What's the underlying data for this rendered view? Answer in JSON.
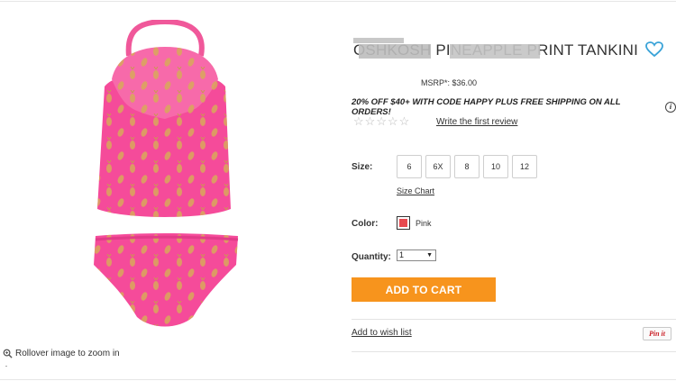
{
  "product": {
    "title": "OSHKOSH PINEAPPLE PRINT TANKINI",
    "msrp": "MSRP*: $36.00",
    "promo": "20% OFF $40+ WITH CODE HAPPY PLUS FREE SHIPPING ON ALL ORDERS!",
    "review_link": "Write the first review",
    "rating": {
      "value": 0,
      "max": 5
    }
  },
  "image": {
    "zoom_hint": "Rollover image to zoom in"
  },
  "size": {
    "label": "Size:",
    "options": [
      "6",
      "6X",
      "8",
      "10",
      "12"
    ],
    "chart_link": "Size Chart"
  },
  "color": {
    "label": "Color:",
    "name": "Pink",
    "swatch": "#e8494f"
  },
  "quantity": {
    "label": "Quantity:",
    "value": "1"
  },
  "actions": {
    "add_to_cart": "ADD TO CART",
    "wishlist": "Add to wish list",
    "pinit": "Pin it"
  },
  "colors": {
    "accent": "#f7941d",
    "heart": "#3aa3d8",
    "pin": "#cb2027"
  }
}
